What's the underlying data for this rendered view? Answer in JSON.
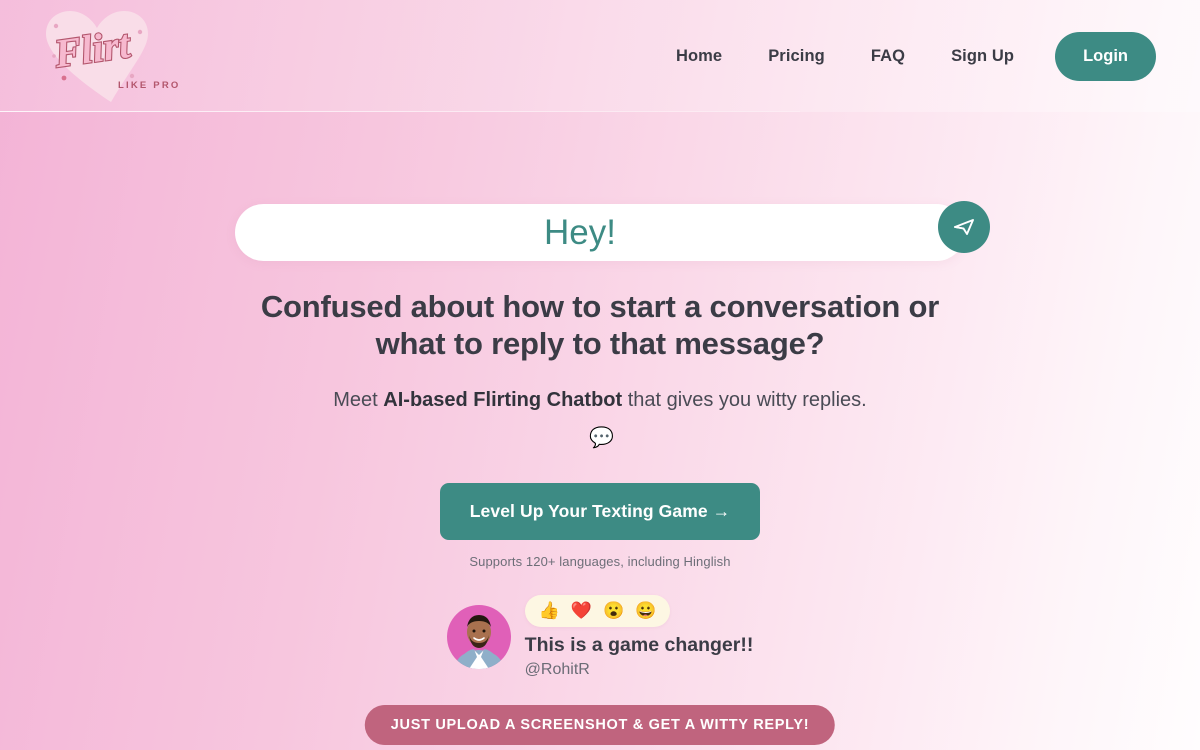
{
  "brand": {
    "name": "Flirt",
    "tagline": "LIKE PRO",
    "logo_icon": "heart-logo-icon"
  },
  "header": {
    "nav": [
      {
        "label": "Home",
        "name": "nav-link-home"
      },
      {
        "label": "Pricing",
        "name": "nav-link-pricing"
      },
      {
        "label": "FAQ",
        "name": "nav-link-faq"
      },
      {
        "label": "Sign Up",
        "name": "nav-link-signup"
      }
    ],
    "login_label": "Login"
  },
  "hero": {
    "search_value": "Hey!",
    "search_placeholder": "Hey!",
    "send_icon": "send-paper-plane-icon",
    "headline": "Confused about how to start a conversation or what to reply to that message?",
    "subhead_pre": "Meet ",
    "subhead_bold": "AI-based Flirting Chatbot",
    "subhead_post": " that gives you witty replies.",
    "subhead_emoji": "💬",
    "cta_label": "Level Up Your Texting Game →",
    "cta_note": "Supports 120+ languages, including Hinglish"
  },
  "testimonial": {
    "avatar_icon": "user-avatar",
    "reactions": [
      "👍",
      "❤️",
      "😮",
      "😀"
    ],
    "quote": "This is a game changer!!",
    "handle": "@RohitR"
  },
  "banner": {
    "label": "JUST UPLOAD A SCREENSHOT & GET A WITTY REPLY!"
  },
  "colors": {
    "teal": "#3d8b84",
    "rose": "#c0647e",
    "pink_bg_start": "#f3b3d6",
    "pink_bg_end": "#fffdfe",
    "heading": "#3b3c46"
  }
}
